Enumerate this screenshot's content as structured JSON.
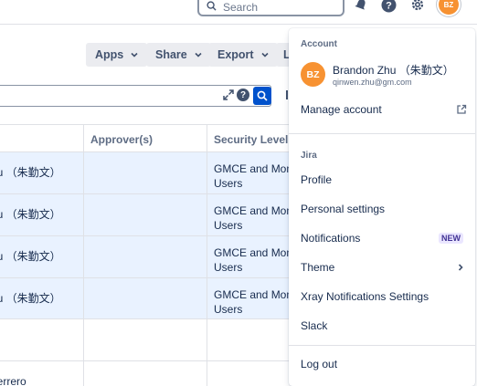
{
  "topbar": {
    "search_placeholder": "Search",
    "icons": [
      "notifications-icon",
      "help-icon",
      "settings-icon"
    ],
    "avatar_initials": "BZ"
  },
  "toolbar": {
    "apps_label": "Apps",
    "share_label": "Share",
    "export_label": "Export",
    "partial_label": "L"
  },
  "table": {
    "columns": [
      {
        "key": "assignee",
        "label": ""
      },
      {
        "key": "approvers",
        "label": "Approver(s)"
      },
      {
        "key": "security",
        "label": "Security Level"
      }
    ],
    "rows": [
      {
        "assignee": "nu （朱勤文）",
        "approvers": "",
        "security": "GMCE and Mome\nUsers",
        "selected": true
      },
      {
        "assignee": "nu （朱勤文）",
        "approvers": "",
        "security": "GMCE and Mome\nUsers",
        "selected": true
      },
      {
        "assignee": "nu （朱勤文）",
        "approvers": "",
        "security": "GMCE and Mome\nUsers",
        "selected": true
      },
      {
        "assignee": "nu （朱勤文）",
        "approvers": "",
        "security": "GMCE and Mome\nUsers",
        "selected": true
      },
      {
        "assignee": "",
        "approvers": "",
        "security": "",
        "selected": false
      },
      {
        "assignee": "uerrero",
        "approvers": "",
        "security": "",
        "selected": false
      }
    ]
  },
  "menu": {
    "account_title": "Account",
    "avatar_initials": "BZ",
    "user_name": "Brandon Zhu （朱勤文）",
    "user_email": "qinwen.zhu@gm.com",
    "manage_account": "Manage account",
    "jira_title": "Jira",
    "items": {
      "profile": "Profile",
      "personal_settings": "Personal settings",
      "notifications": "Notifications",
      "notifications_badge": "NEW",
      "theme": "Theme",
      "xray": "Xray Notifications Settings",
      "slack": "Slack"
    },
    "logout": "Log out"
  },
  "colors": {
    "brand": "#0052cc",
    "avatar": "#f79232",
    "selected_row": "#e9f2ff",
    "badge_bg": "#eae6ff",
    "badge_fg": "#403294"
  }
}
